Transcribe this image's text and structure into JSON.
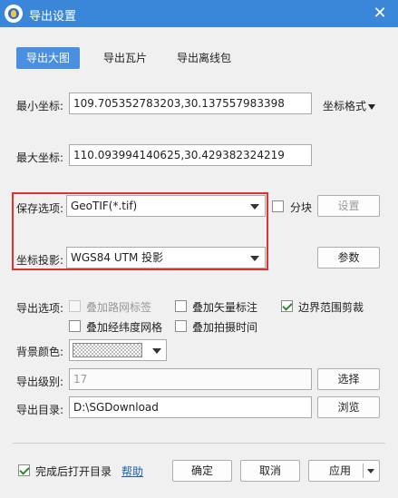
{
  "window": {
    "title": "导出设置",
    "close_glyph": "✕"
  },
  "tabs": [
    {
      "label": "导出大图",
      "active": true
    },
    {
      "label": "导出瓦片",
      "active": false
    },
    {
      "label": "导出离线包",
      "active": false
    }
  ],
  "coords": {
    "min_label": "最小坐标:",
    "min_value": "109.705352783203,30.137557983398",
    "max_label": "最大坐标:",
    "max_value": "110.093994140625,30.429382324219",
    "format_label": "坐标格式"
  },
  "save_option": {
    "label": "保存选项:",
    "value": "GeoTIF(*.tif)",
    "split_label": "分块",
    "split_checked": false,
    "settings_button": "设置"
  },
  "projection": {
    "label": "坐标投影:",
    "value": "WGS84 UTM 投影",
    "params_button": "参数"
  },
  "export_options": {
    "label": "导出选项:",
    "items": [
      {
        "label": "叠加路网标签",
        "checked": false,
        "disabled": true
      },
      {
        "label": "叠加矢量标注",
        "checked": false,
        "disabled": false
      },
      {
        "label": "边界范围剪裁",
        "checked": true,
        "disabled": false
      },
      {
        "label": "叠加经纬度网格",
        "checked": false,
        "disabled": false
      },
      {
        "label": "叠加拍摄时间",
        "checked": false,
        "disabled": false
      }
    ]
  },
  "background": {
    "label": "背景颜色:"
  },
  "level": {
    "label": "导出级别:",
    "value": "17",
    "select_button": "选择"
  },
  "directory": {
    "label": "导出目录:",
    "value": "D:\\SGDownload",
    "browse_button": "浏览"
  },
  "footer": {
    "open_dir_label": "完成后打开目录",
    "open_dir_checked": true,
    "help_link": "帮助",
    "ok_button": "确定",
    "cancel_button": "取消",
    "apply_button": "应用"
  },
  "colors": {
    "titlebar": "#3a86d8",
    "tab_active": "#4a8fe0",
    "highlight_box": "#e03030"
  }
}
